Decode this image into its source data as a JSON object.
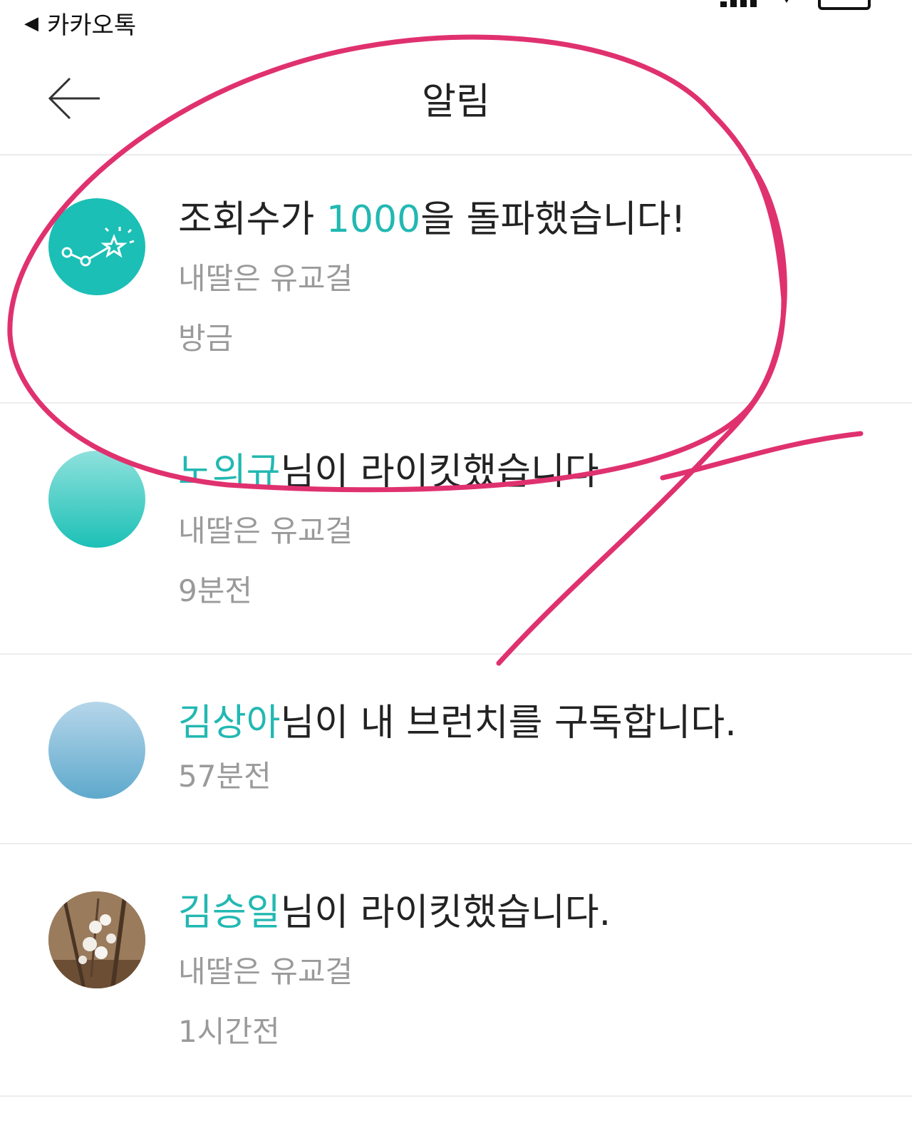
{
  "status_bar": {
    "back_app_label": "카카오톡",
    "icons": [
      "signal-icon",
      "data-arrows-icon",
      "battery-icon"
    ]
  },
  "header": {
    "title": "알림",
    "back_icon": "back-arrow-icon"
  },
  "colors": {
    "accent": "#22b8b2",
    "annotation": "#e0316f",
    "divider": "#ededed"
  },
  "notifications": [
    {
      "icon": "stats-star-icon",
      "text_before": "조회수가 ",
      "highlight": "1000",
      "text_after": "을 돌파했습니다!",
      "source": "내딸은 유교걸",
      "time": "방금"
    },
    {
      "icon": "user-avatar",
      "highlight": "노의규",
      "text_after": "님이 라이킷했습니다",
      "source": "내딸은 유교걸",
      "time": "9분전"
    },
    {
      "icon": "user-avatar",
      "highlight": "김상아",
      "text_after": "님이 내 브런치를 구독합니다.",
      "time": "57분전"
    },
    {
      "icon": "user-photo-avatar",
      "highlight": "김승일",
      "text_after": "님이 라이킷했습니다.",
      "source": "내딸은 유교걸",
      "time": "1시간전"
    }
  ]
}
